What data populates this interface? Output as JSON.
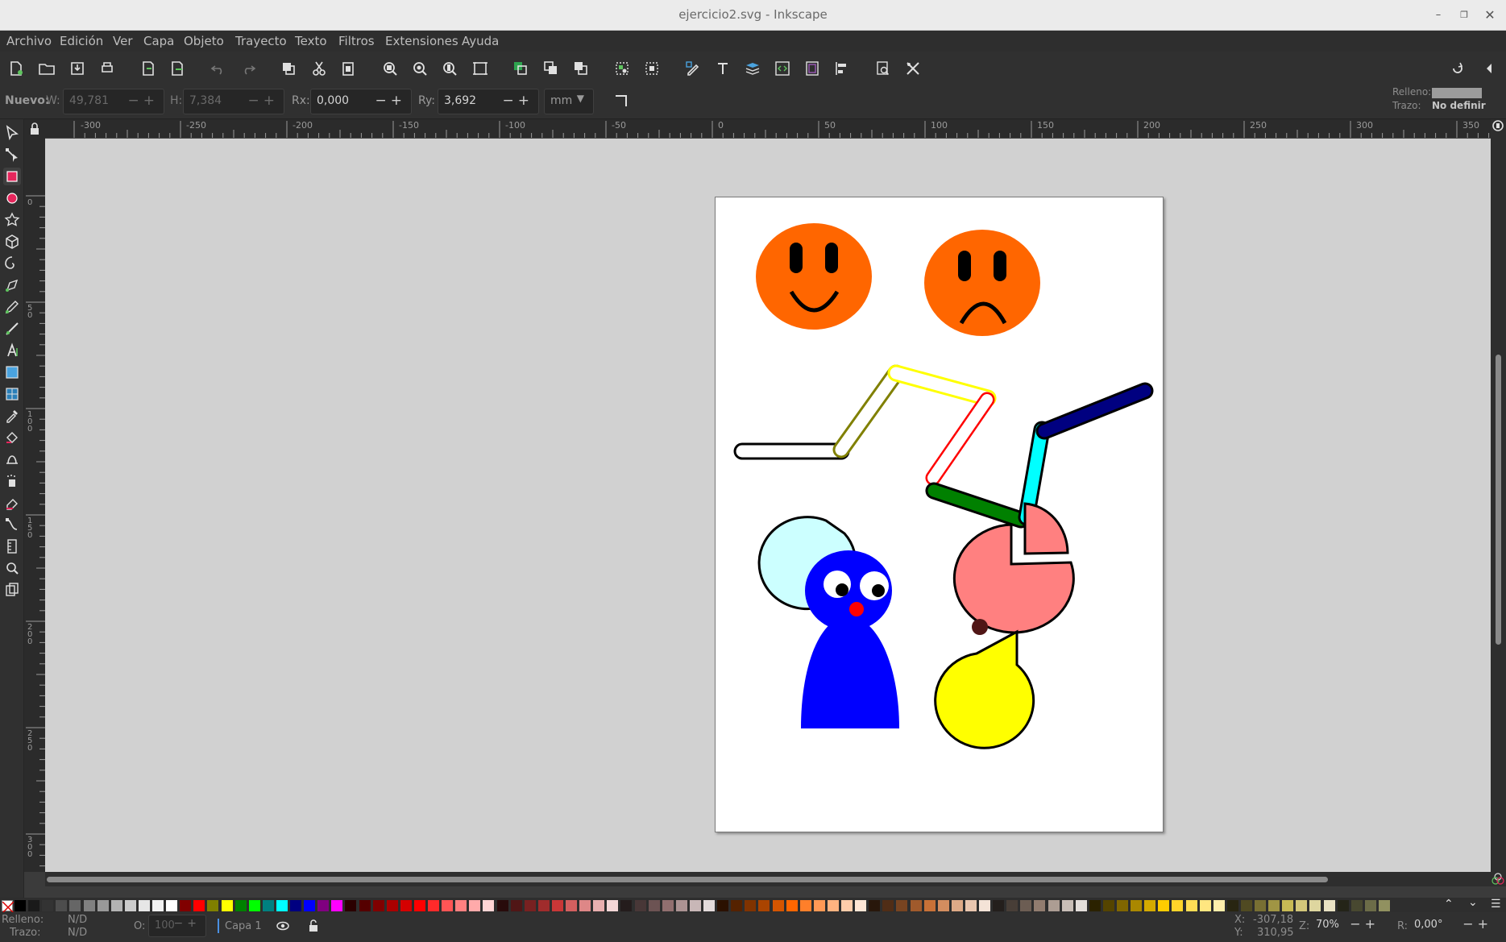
{
  "window": {
    "title": "ejercicio2.svg - Inkscape"
  },
  "menu": [
    "Archivo",
    "Edición",
    "Ver",
    "Capa",
    "Objeto",
    "Trayecto",
    "Texto",
    "Filtros",
    "Extensiones",
    "Ayuda"
  ],
  "controls": {
    "new_label": "Nuevo:",
    "w_label": "W:",
    "w_value": "49,781",
    "h_label": "H:",
    "h_value": "7,384",
    "rx_label": "Rx:",
    "rx_value": "0,000",
    "ry_label": "Ry:",
    "ry_value": "3,692",
    "unit": "mm"
  },
  "style_indicator": {
    "fill_label": "Relleno:",
    "stroke_label": "Trazo:",
    "stroke_value": "No definir"
  },
  "ruler_h_labels": [
    "-300",
    "-250",
    "-200",
    "-150",
    "-100",
    "-50",
    "0",
    "50",
    "100",
    "150",
    "200",
    "250",
    "300",
    "350"
  ],
  "ruler_v_labels": [
    "0",
    "50",
    "100",
    "150",
    "200",
    "250",
    "300"
  ],
  "status": {
    "fill_label": "Relleno:",
    "fill_value": "N/D",
    "stroke_label": "Trazo:",
    "stroke_value": "N/D",
    "opacity_label": "O:",
    "opacity_value": "100",
    "layer": "Capa 1",
    "x_label": "X:",
    "x_value": "-307,18",
    "y_label": "Y:",
    "y_value": "310,95",
    "zoom_label": "Z:",
    "zoom_value": "70%",
    "rotation_label": "R:",
    "rotation_value": "0,00°"
  },
  "palette_colors": [
    "#000000",
    "#1a1a1a",
    "#333333",
    "#4d4d4d",
    "#666666",
    "#808080",
    "#999999",
    "#b3b3b3",
    "#cccccc",
    "#e6e6e6",
    "#f2f2f2",
    "#ffffff",
    "#800000",
    "#ff0000",
    "#808000",
    "#ffff00",
    "#008000",
    "#00ff00",
    "#008080",
    "#00ffff",
    "#000080",
    "#0000ff",
    "#800080",
    "#ff00ff",
    "#2b0000",
    "#550000",
    "#800000",
    "#aa0000",
    "#d40000",
    "#ff0000",
    "#ff2a2a",
    "#ff5555",
    "#ff8080",
    "#ffaaaa",
    "#ffd5d5",
    "#280b0b",
    "#501616",
    "#782121",
    "#a02c2c",
    "#c83737",
    "#d35f5f",
    "#de8787",
    "#e9afaf",
    "#f4d7d7",
    "#241c1c",
    "#483737",
    "#6c5353",
    "#916f6f",
    "#ac9393",
    "#c8b7b7",
    "#e3dbdb",
    "#2b1100",
    "#552200",
    "#803300",
    "#aa4400",
    "#d45500",
    "#ff6600",
    "#ff7f2a",
    "#ff9955",
    "#ffb380",
    "#ffccaa",
    "#ffe6d5",
    "#28170b",
    "#502d16",
    "#784421",
    "#a05a2c",
    "#c87137",
    "#d38d5f",
    "#deaa87",
    "#e9c6af",
    "#f4e3d7",
    "#241f1c",
    "#483e37",
    "#6c5d53",
    "#917c6f",
    "#ac9d93",
    "#c8beb7",
    "#e3dedb",
    "#2b2200",
    "#554400",
    "#806600",
    "#aa8800",
    "#d4aa00",
    "#ffcc00",
    "#ffd42a",
    "#ffdd55",
    "#ffe680",
    "#ffeeaa",
    "#282511",
    "#504a22",
    "#786f33",
    "#a09544",
    "#c8ba55",
    "#d3c77a",
    "#ded69f",
    "#e9e2c3",
    "#242418",
    "#484830",
    "#6c6c48",
    "#919160"
  ]
}
